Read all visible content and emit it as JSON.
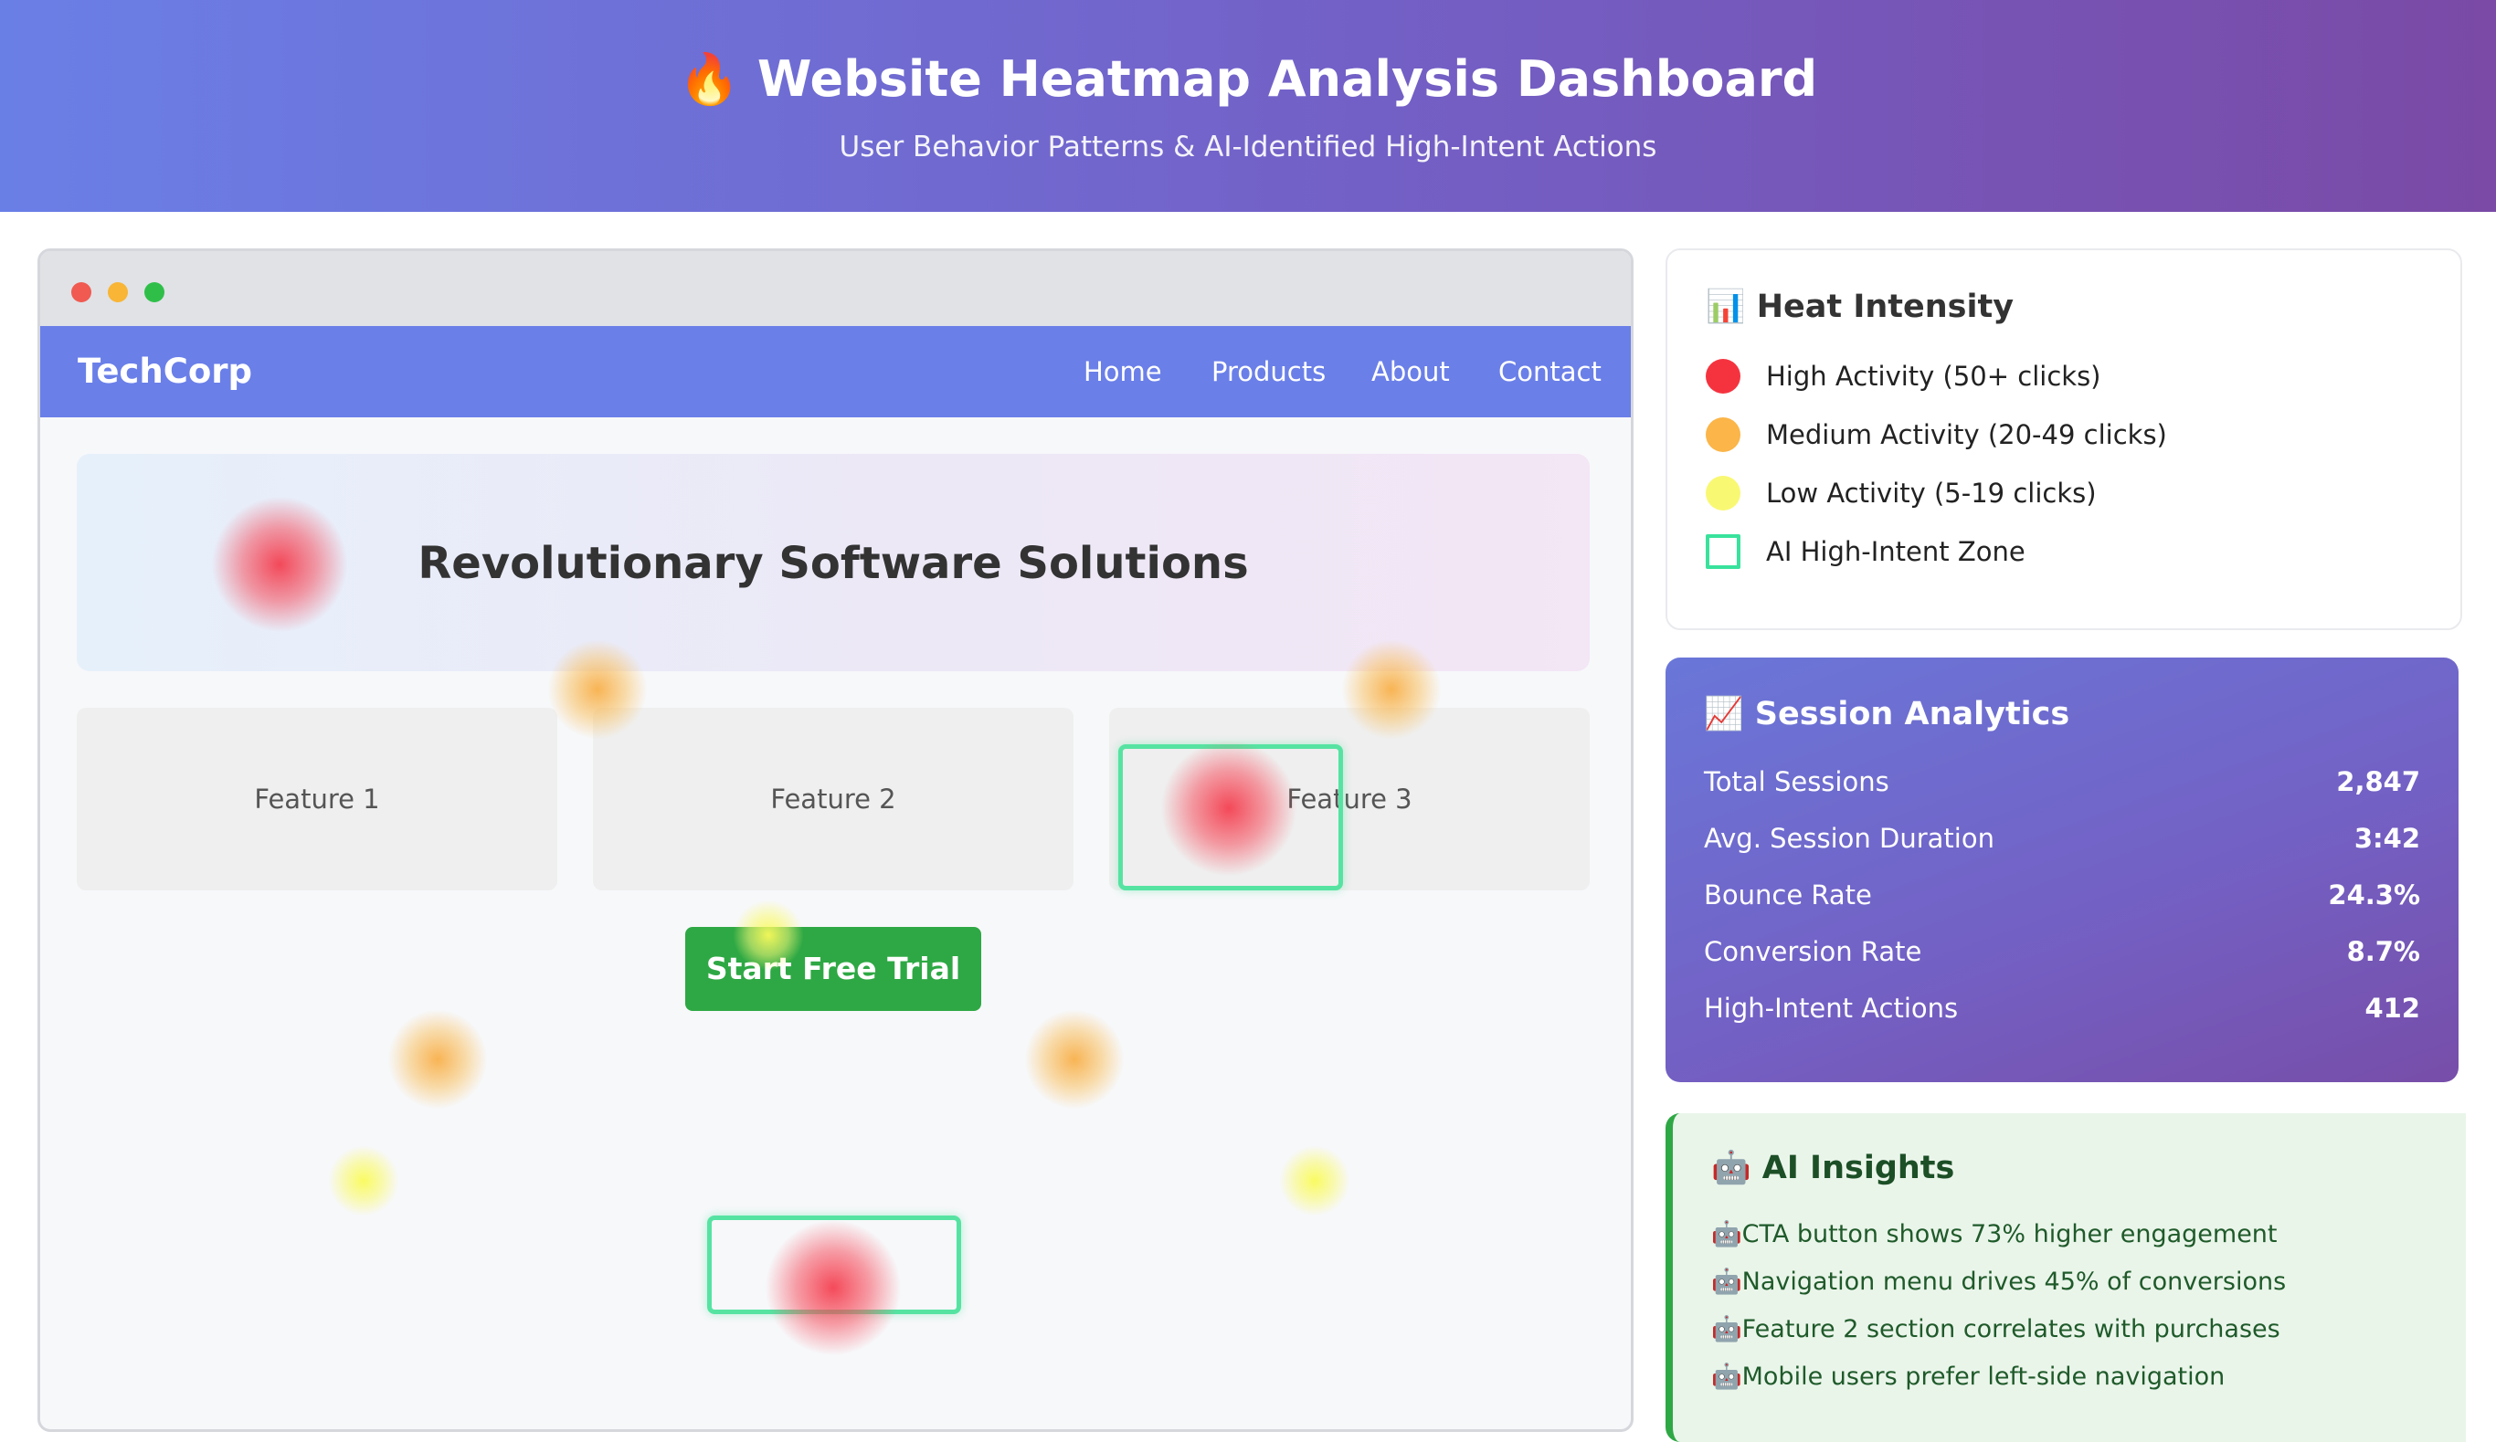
{
  "header": {
    "title": "🔥 Website Heatmap Analysis Dashboard",
    "subtitle": "User Behavior Patterns & AI-Identified High-Intent Actions"
  },
  "mock_site": {
    "brand": "TechCorp",
    "nav": [
      "Home",
      "Products",
      "About",
      "Contact"
    ],
    "hero_title": "Revolutionary Software Solutions",
    "features": [
      "Feature 1",
      "Feature 2",
      "Feature 3"
    ],
    "cta_label": "Start Free Trial"
  },
  "legend": {
    "title": "📊 Heat Intensity",
    "items": [
      {
        "label": "High Activity (50+ clicks)",
        "color": "#f5333f"
      },
      {
        "label": "Medium Activity (20-49 clicks)",
        "color": "#fbb548"
      },
      {
        "label": "Low Activity (5-19 clicks)",
        "color": "#f9f872"
      },
      {
        "label": "AI High-Intent Zone",
        "color": "#39e29c"
      }
    ]
  },
  "session": {
    "title": "📈 Session Analytics",
    "stats": [
      {
        "label": "Total Sessions",
        "value": "2,847"
      },
      {
        "label": "Avg. Session Duration",
        "value": "3:42"
      },
      {
        "label": "Bounce Rate",
        "value": "24.3%"
      },
      {
        "label": "Conversion Rate",
        "value": "8.7%"
      },
      {
        "label": "High-Intent Actions",
        "value": "412"
      }
    ]
  },
  "insights": {
    "title": "🤖 AI Insights",
    "items": [
      "🤖CTA button shows 73% higher engagement",
      "🤖Navigation menu drives 45% of conversions",
      "🤖Feature 2 section correlates with purchases",
      "🤖Mobile users prefer left-side navigation"
    ]
  },
  "colors": {
    "accent": "#6a7fe8",
    "cta": "#2ea844",
    "ai_zone": "#56e3a2"
  }
}
